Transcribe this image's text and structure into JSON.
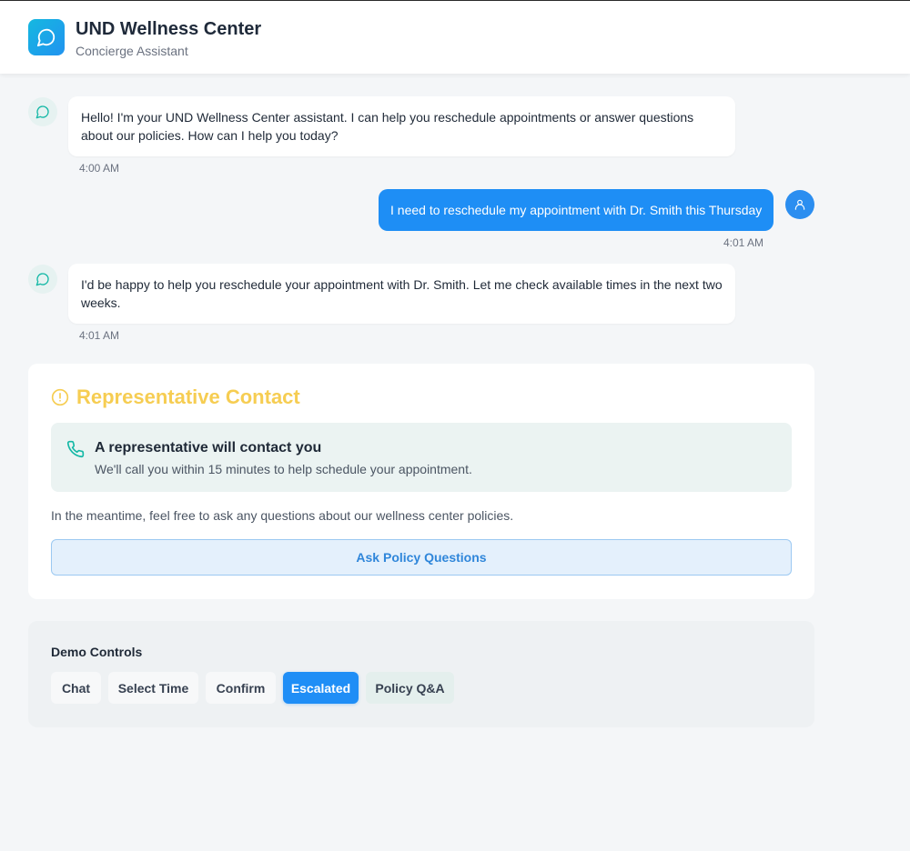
{
  "header": {
    "title": "UND Wellness Center",
    "subtitle": "Concierge Assistant"
  },
  "messages": [
    {
      "sender": "bot",
      "text": "Hello! I'm your UND Wellness Center assistant. I can help you reschedule appointments or answer questions about our policies. How can I help you today?",
      "time": "4:00 AM"
    },
    {
      "sender": "user",
      "text": "I need to reschedule my appointment with Dr. Smith this Thursday",
      "time": "4:01 AM"
    },
    {
      "sender": "bot",
      "text": "I'd be happy to help you reschedule your appointment with Dr. Smith. Let me check available times in the next two weeks.",
      "time": "4:01 AM"
    }
  ],
  "escalation": {
    "title": "Representative Contact",
    "notice_title": "A representative will contact you",
    "notice_text": "We'll call you within 15 minutes to help schedule your appointment.",
    "meantime_text": "In the meantime, feel free to ask any questions about our wellness center policies.",
    "button_label": "Ask Policy Questions"
  },
  "demo_controls": {
    "title": "Demo Controls",
    "buttons": [
      {
        "label": "Chat",
        "state": "default"
      },
      {
        "label": "Select Time",
        "state": "default"
      },
      {
        "label": "Confirm",
        "state": "default"
      },
      {
        "label": "Escalated",
        "state": "active"
      },
      {
        "label": "Policy Q&A",
        "state": "alt"
      }
    ]
  },
  "colors": {
    "accent": "#1e8ef5",
    "warning": "#f6cd52",
    "teal": "#14b8a6"
  },
  "icons": {
    "logo": "message-circle-icon",
    "bot_avatar": "message-circle-icon",
    "user_avatar": "user-icon",
    "alert": "alert-circle-icon",
    "phone": "phone-icon"
  }
}
